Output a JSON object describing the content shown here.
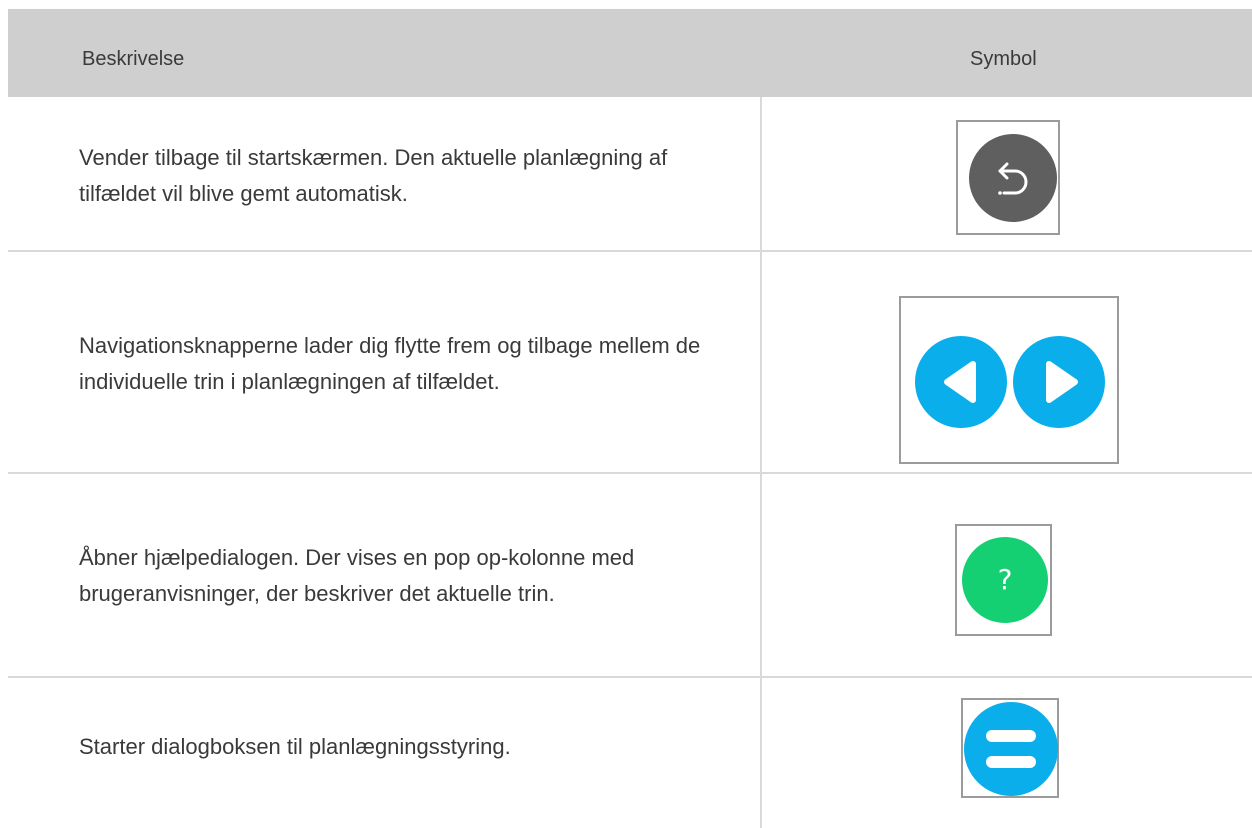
{
  "table": {
    "headers": {
      "description": "Beskrivelse",
      "symbol": "Symbol"
    },
    "rows": [
      {
        "description": "Vender tilbage til startskærmen. Den aktuelle planlægning af tilfældet vil blive gemt automatisk.",
        "icon": "return-icon",
        "icon_color": "#5f5f5f"
      },
      {
        "description": "Navigationsknapperne lader dig flytte frem og tilbage mellem de individuelle trin i planlægningen af tilfældet.",
        "icon": "navigation-arrows-icon",
        "icon_color": "#0aaeea"
      },
      {
        "description": "Åbner hjælpedialogen. Der vises en pop op-kolonne med brugeranvisninger, der beskriver det aktuelle trin.",
        "icon": "help-icon",
        "icon_glyph": "?",
        "icon_color": "#15cf73"
      },
      {
        "description": "Starter dialogboksen til planlægningsstyring.",
        "icon": "menu-icon",
        "icon_color": "#0aaeea"
      }
    ]
  },
  "colors": {
    "header_bg": "#cfcfcf",
    "border": "#d9d9d9",
    "text": "#3a3a3a"
  }
}
